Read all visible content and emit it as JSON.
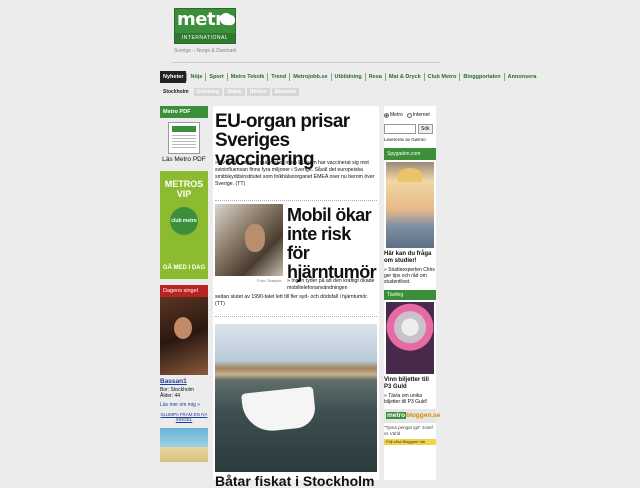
{
  "header": {
    "logo_word": "metro",
    "logo_sub": "INTERNATIONAL",
    "tagline": "Sverige – Norge & Danmark"
  },
  "nav": {
    "items": [
      {
        "label": "Nyheter",
        "active": true
      },
      {
        "label": "Nöje"
      },
      {
        "label": "Sport"
      },
      {
        "label": "Metro Teknik"
      },
      {
        "label": "Trend"
      },
      {
        "label": "Metrojobb.se"
      },
      {
        "label": "Utbildning"
      },
      {
        "label": "Resa"
      },
      {
        "label": "Mat & Dryck"
      },
      {
        "label": "Club Metro"
      },
      {
        "label": "Bloggportalen"
      },
      {
        "label": "Annonsera"
      }
    ],
    "sub_items": [
      {
        "label": "Stockholm",
        "active": true
      },
      {
        "label": "Göteborg"
      },
      {
        "label": "Skåne"
      },
      {
        "label": "Utrikes"
      },
      {
        "label": "Ekonomi"
      }
    ]
  },
  "left": {
    "pdf_box_title": "Metro PDF",
    "pdf_label": "Läs Metro PDF",
    "vip_line1": "METROS",
    "vip_line2": "VIP",
    "vip_badge": "club metro",
    "vip_cta": "GÅ MED I DAG",
    "singel_title": "Dagens singel",
    "singel_name": "Bassan1",
    "singel_info": "Bor: Stockholm\nÅlder: 44",
    "singel_more": "Läs mer om mig »",
    "singel_random": "SLUMPA FRAM EN NY SINGEL"
  },
  "main": {
    "headline1": "EU-organ prisar Sveriges vaccinering",
    "teaser1": "Av de tio miljoner människor inom EU som har vaccinerat sig mot svininfluensan finns fyra miljoner i Sverige. Såväl det europeiska smittskyddsinstitutet som folkhälsoorganet EMEA oser nu berom över Sverige. (TT)",
    "headline2": "Mobil ökar inte risk för hjärntumör",
    "photo_credit": "Foto: Scanpix",
    "teaser2": "Ingen tyder på att den kraftigt ökade mobiltelefonanvändningen",
    "teaser2b": "sedan slutet av 1990-talet lett till fler syd- och dödsfall i hjärntumör. (TT)",
    "headline3": "Båtar fiskat i Stockholm"
  },
  "right": {
    "radio_metro": "Metro",
    "radio_internet": "Internet",
    "search_placeholder": "",
    "search_button": "Sök",
    "powered_by": "Levereras av Gwmro",
    "spy_title_box": "Spygaden.com",
    "spy_title": "Här kan du fråga om studier!",
    "spy_text": "Studieexperten Chris ger tips och råd om studentlivet.",
    "tav_title_box": "Tävling",
    "tav_title": "Vinn biljetter till P3 Guld",
    "tav_text": "Tävla om unika biljetter till P3 Guld!",
    "bloggen_m": "metro",
    "bloggen_b": "bloggen.se",
    "blog_quote": "\"Tjena pengar igit\" Josef vs Värld",
    "blog_bar": "Följ våra Bloggare här"
  }
}
